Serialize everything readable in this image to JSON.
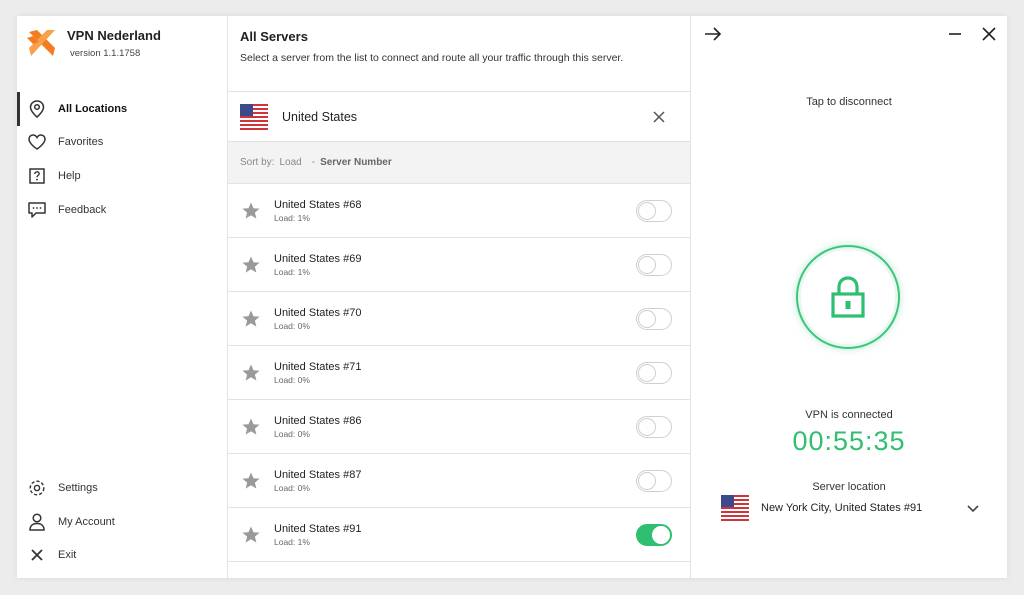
{
  "app": {
    "name": "VPN Nederland",
    "version": "version 1.1.1758",
    "brand_color": "#f47c20",
    "accent_color": "#2fbf71"
  },
  "sidebar": {
    "items": [
      {
        "label": "All Locations",
        "icon": "location-pin-icon",
        "active": true
      },
      {
        "label": "Favorites",
        "icon": "heart-icon",
        "active": false
      },
      {
        "label": "Help",
        "icon": "help-icon",
        "active": false
      },
      {
        "label": "Feedback",
        "icon": "feedback-icon",
        "active": false
      }
    ],
    "bottom_items": [
      {
        "label": "Settings",
        "icon": "gear-icon"
      },
      {
        "label": "My Account",
        "icon": "user-icon"
      },
      {
        "label": "Exit",
        "icon": "close-icon"
      }
    ]
  },
  "servers_panel": {
    "title": "All Servers",
    "subtitle": "Select a server from the list to connect and route all your traffic through this server.",
    "country": "United States",
    "sort": {
      "label": "Sort by:",
      "options": [
        "Load",
        "Server Number"
      ],
      "separator": "-",
      "active": "Server Number"
    },
    "servers": [
      {
        "name": "United States #68",
        "load": "Load: 1%",
        "connected": false
      },
      {
        "name": "United States #69",
        "load": "Load: 1%",
        "connected": false
      },
      {
        "name": "United States #70",
        "load": "Load: 0%",
        "connected": false
      },
      {
        "name": "United States #71",
        "load": "Load: 0%",
        "connected": false
      },
      {
        "name": "United States #86",
        "load": "Load: 0%",
        "connected": false
      },
      {
        "name": "United States #87",
        "load": "Load: 0%",
        "connected": false
      },
      {
        "name": "United States #91",
        "load": "Load: 1%",
        "connected": true
      }
    ]
  },
  "connection": {
    "tap_text": "Tap to disconnect",
    "status": "VPN is connected",
    "timer": "00:55:35",
    "location_label": "Server location",
    "location": "New York City, United States #91"
  }
}
